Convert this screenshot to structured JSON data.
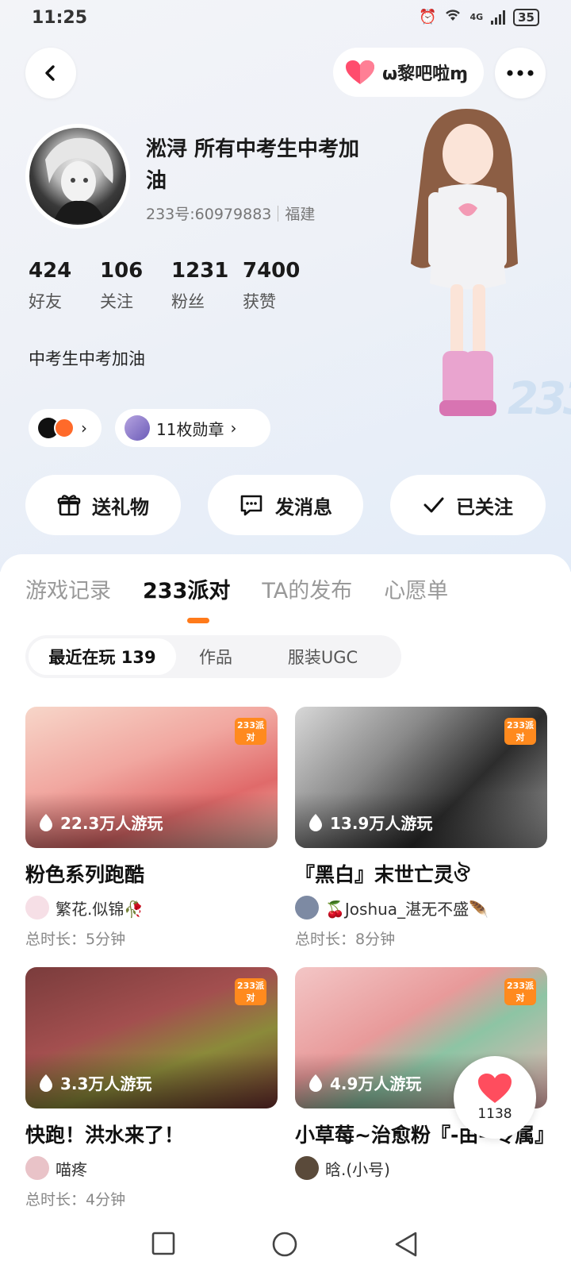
{
  "status_bar": {
    "time": "11:25",
    "network": "4G",
    "battery": "35"
  },
  "header": {
    "couple_name": "ω黎吧啦ɱ"
  },
  "profile": {
    "name": "淞浔 所有中考生中考加油",
    "user_id": "233号:60979883",
    "location": "福建",
    "bio": "中考生中考加油",
    "stats": [
      {
        "value": "424",
        "label": "好友"
      },
      {
        "value": "106",
        "label": "关注"
      },
      {
        "value": "1231",
        "label": "粉丝"
      },
      {
        "value": "7400",
        "label": "获赞"
      }
    ],
    "badges_label": "11枚勋章",
    "platform_mark": "233"
  },
  "actions": {
    "gift": "送礼物",
    "message": "发消息",
    "followed": "已关注"
  },
  "tabs": [
    "游戏记录",
    "233派对",
    "TA的发布",
    "心愿单"
  ],
  "active_tab": "233派对",
  "sub_tabs": {
    "recent": "最近在玩 139",
    "works": "作品",
    "ugc": "服装UGC"
  },
  "games": [
    {
      "title": "粉色系列跑酷",
      "plays": "22.3万人游玩",
      "author": "繁花.似锦🥀",
      "duration": "总时长：5分钟",
      "logo": "233派对"
    },
    {
      "title": "『黑白』末世亡灵ঔ",
      "plays": "13.9万人游玩",
      "author": "🍒Joshua_湛无不盛🪶",
      "duration": "总时长：8分钟",
      "logo": "233派对"
    },
    {
      "title": "快跑！洪水来了！",
      "plays": "3.3万人游玩",
      "author": "喵疼",
      "duration": "总时长：4分钟",
      "logo": "233派对"
    },
    {
      "title": "小草莓~治愈粉『-由--专属』",
      "plays": "4.9万人游玩",
      "author": "晗.(小号)",
      "duration": "",
      "logo": "233派对"
    }
  ],
  "like_float": {
    "count": "1138"
  },
  "colors": {
    "accent": "#ff7a1a",
    "heart": "#ff4d5e"
  }
}
